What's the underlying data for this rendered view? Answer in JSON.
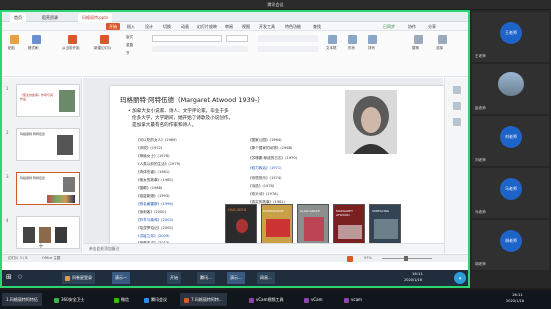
{
  "meeting": {
    "title": "腾讯会议"
  },
  "wps": {
    "tabs": [
      "首页",
      "稻壳资源",
      "玛格丽特.pptx"
    ],
    "menu": [
      "开始",
      "插入",
      "设计",
      "切换",
      "动画",
      "幻灯片放映",
      "审阅",
      "视图",
      "开发工具",
      "特色功能",
      "查找"
    ],
    "menu_right": [
      "已同步",
      "协作",
      "分享"
    ],
    "tool_labels": [
      "粘贴",
      "格式刷",
      "从当前开始",
      "新建幻灯片",
      "版式",
      "重置",
      "节",
      "文本框",
      "形状",
      "排列",
      "替换",
      "选择"
    ]
  },
  "thumbs": [
    {
      "num": "1",
      "text": "《使女的故事》作者与其作品"
    },
    {
      "num": "2",
      "text": "玛格丽特·阿特伍德"
    },
    {
      "num": "3",
      "text": "玛格丽特·阿特伍德"
    },
    {
      "num": "4",
      "text": ""
    }
  ],
  "slide": {
    "title": "玛格丽特·阿特伍德（Margaret Atwood 1939-）",
    "bullets": [
      "• 加拿大女小说家、诗人、文学评论家。毕业于多",
      "伦多大学，大学期间，她开始了诗歌及小说创作，",
      "是加拿大最有名的作家和诗人。"
    ],
    "col_left": [
      "《可以吃的女人》(1969)",
      "《浮现》(1972)",
      "《神谕女士》(1976)",
      "《人类以前的生活》(1979)",
      "《肉体伤害》(1981)",
      "《使女的故事》(1985)",
      "《猫眼》(1988)",
      "《强盗新娘》(1993)",
      "《别名格雷斯》(1996)",
      "《盲刺客》(2000)",
      "《羚羊与秧鸡》(2003)",
      "《珀涅罗珀记》(2005)",
      "《洪疫之年》(2009)",
      "《疯癫亚当》(2013)"
    ],
    "col_right": [
      "《国家公园》(1964)",
      "《那个国家的动物》(1968)",
      "《苏珊娜·穆迪的日志》(1970)",
      "《权力政治》(1971)",
      "《你很快乐》(1974)",
      "《诗选》(1976)",
      "《双头诗》(1978)",
      "《真实的故事》(1981)"
    ],
    "books": [
      "HAG-SEED",
      "MADDADDAM",
      "ALIAS GRACE",
      "MARGARET ATWOOD",
      "SURFACING"
    ]
  },
  "notes": {
    "placeholder": "单击此处添加备注"
  },
  "status": {
    "slide_count": "幻灯片 3 / 8",
    "theme": "Office 主题",
    "zoom": "97%"
  },
  "win_taskbar": {
    "items": [
      "问卷星登录",
      "演示一",
      "开始",
      "腾讯...",
      "演示...",
      "网易..."
    ],
    "time": "16:11",
    "date": "2020/1/16"
  },
  "participants": [
    {
      "name": "王老师",
      "color": "#1e63c7"
    },
    {
      "name": "赵老师",
      "color": "#7a8b99"
    },
    {
      "name": "刘老师",
      "color": "#1e63c7"
    },
    {
      "name": "马老师",
      "color": "#1e63c7"
    },
    {
      "name": "胡老师",
      "color": "#1e63c7"
    }
  ],
  "bottom_taskbar": {
    "items": [
      "1.玛格丽特阿特伍",
      "360安全卫士",
      "微信",
      "腾讯会议",
      "7.玛格丽特阿特...",
      "vCam视频工具",
      "vCam",
      "vcam"
    ],
    "time": "16:11",
    "date": "2020/1/16"
  }
}
